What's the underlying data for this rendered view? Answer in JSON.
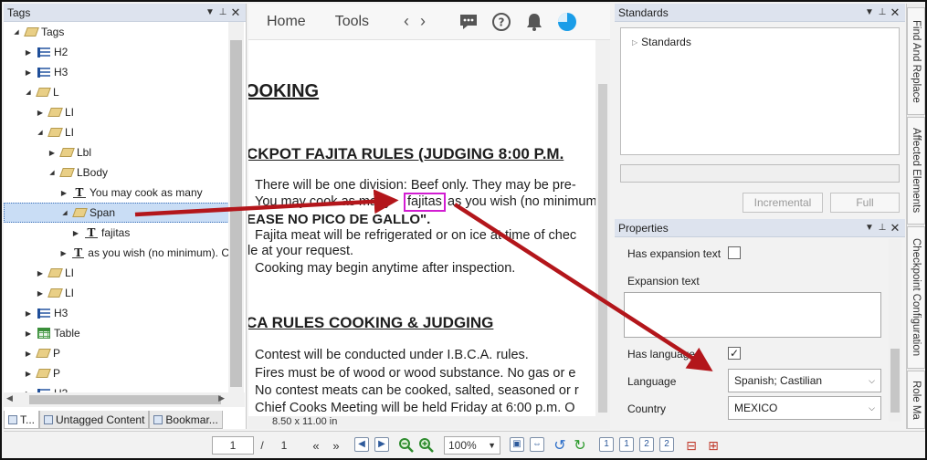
{
  "tags_panel": {
    "title": "Tags",
    "tree": [
      {
        "depth": 0,
        "toggle": "open",
        "icon": "tag-icon",
        "label": "Tags"
      },
      {
        "depth": 1,
        "toggle": "closed",
        "icon": "heading-icon",
        "label": "H2"
      },
      {
        "depth": 1,
        "toggle": "closed",
        "icon": "heading-icon",
        "label": "H3"
      },
      {
        "depth": 1,
        "toggle": "open",
        "icon": "tag-icon",
        "label": "L"
      },
      {
        "depth": 2,
        "toggle": "closed",
        "icon": "tag-icon",
        "label": "LI"
      },
      {
        "depth": 2,
        "toggle": "open",
        "icon": "tag-icon",
        "label": "LI"
      },
      {
        "depth": 3,
        "toggle": "closed",
        "icon": "tag-icon",
        "label": "Lbl"
      },
      {
        "depth": 3,
        "toggle": "open",
        "icon": "tag-icon",
        "label": "LBody"
      },
      {
        "depth": 4,
        "toggle": "closed",
        "icon": "text-icon",
        "label": "You may cook as many"
      },
      {
        "depth": 4,
        "toggle": "open",
        "icon": "tag-icon",
        "label": "Span",
        "selected": true
      },
      {
        "depth": 5,
        "toggle": "closed",
        "icon": "text-icon",
        "label": "fajitas"
      },
      {
        "depth": 4,
        "toggle": "closed",
        "icon": "text-icon",
        "label": "as you wish (no minimum). C"
      },
      {
        "depth": 2,
        "toggle": "closed",
        "icon": "tag-icon",
        "label": "LI"
      },
      {
        "depth": 2,
        "toggle": "closed",
        "icon": "tag-icon",
        "label": "LI"
      },
      {
        "depth": 1,
        "toggle": "closed",
        "icon": "heading-icon",
        "label": "H3"
      },
      {
        "depth": 1,
        "toggle": "closed",
        "icon": "table-icon",
        "label": "Table"
      },
      {
        "depth": 1,
        "toggle": "closed",
        "icon": "tag-icon",
        "label": "P"
      },
      {
        "depth": 1,
        "toggle": "closed",
        "icon": "tag-icon",
        "label": "P"
      },
      {
        "depth": 1,
        "toggle": "closed",
        "icon": "heading-icon",
        "label": "H3"
      }
    ],
    "tabs": [
      {
        "label": "T..."
      },
      {
        "label": "Untagged Content"
      },
      {
        "label": "Bookmar..."
      }
    ]
  },
  "doc_toolbar": {
    "home": "Home",
    "tools": "Tools",
    "back": "‹",
    "forward": "›"
  },
  "document": {
    "lines": [
      {
        "text": "OOKING",
        "style": "h1"
      },
      {
        "text": "CKPOT FAJITA RULES (JUDGING 8:00 P.M.",
        "style": "h2"
      },
      {
        "text": "There will be one division: Beef only. They may be pre-",
        "style": "para"
      },
      {
        "text": "You may cook as many",
        "style": "para"
      },
      {
        "text": "fajitas",
        "style": "para"
      },
      {
        "text": "as you wish (no minimum",
        "style": "para"
      },
      {
        "text": "EASE NO PICO DE GALLO\".",
        "style": "bold"
      },
      {
        "text": "Fajita meat will be refrigerated or on ice at time of  chec",
        "style": "para"
      },
      {
        "text": "le at             your request.",
        "style": "para"
      },
      {
        "text": "Cooking may begin anytime after inspection.",
        "style": "para"
      },
      {
        "text": "CA RULES COOKING & JUDGING",
        "style": "h2"
      },
      {
        "text": "Contest will be conducted under I.B.C.A. rules.",
        "style": "para"
      },
      {
        "text": "Fires must be of wood or wood substance.  No gas or e",
        "style": "para"
      },
      {
        "text": "No contest meats can be cooked, salted, seasoned or r",
        "style": "para"
      },
      {
        "text": "Chief Cooks Meeting will be held Friday at 6:00 p.m.  O",
        "style": "para"
      }
    ],
    "page_size": "8.50 x 11.00 in"
  },
  "standards_panel": {
    "title": "Standards",
    "tree_item": "Standards",
    "incremental": "Incremental",
    "full": "Full"
  },
  "properties_panel": {
    "title": "Properties",
    "has_expansion_text": "Has expansion text",
    "has_expansion_checked": false,
    "expansion_text": "Expansion text",
    "has_language": "Has language",
    "has_language_checked": true,
    "language_label": "Language",
    "language_value": "Spanish; Castilian",
    "country_label": "Country",
    "country_value": "MEXICO"
  },
  "side_rail": [
    {
      "label": "Find And Replace"
    },
    {
      "label": "Affected Elements"
    },
    {
      "label": "Checkpoint Configuration"
    },
    {
      "label": "Role Ma"
    }
  ],
  "bottom_toolbar": {
    "page_current": "1",
    "page_sep": "/",
    "page_total": "1",
    "zoom": "100%"
  },
  "colors": {
    "highlight_box": "#d21dd2",
    "annotation_arrow": "#b3161b",
    "selection": "#c9ddf5"
  }
}
